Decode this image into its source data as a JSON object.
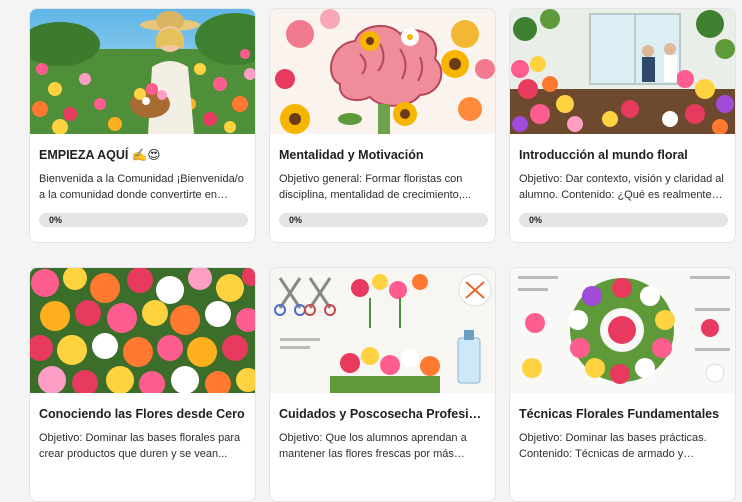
{
  "courses": [
    {
      "title": "EMPIEZA AQUÍ ✍️😍",
      "description": "Bienvenida a la Comunidad ¡Bienvenida/o a la comunidad donde convertirte en florista...",
      "progress_label": "0%",
      "progress": 0,
      "image": "woman-in-flower-field"
    },
    {
      "title": "Mentalidad y Motivación",
      "description": "Objetivo general: Formar floristas con disciplina, mentalidad de crecimiento,...",
      "progress_label": "0%",
      "progress": 0,
      "image": "brain-with-flowers"
    },
    {
      "title": "Introducción al mundo floral",
      "description": "Objetivo: Dar contexto, visión y claridad al alumno. Contenido: ¿Qué es realmente ser...",
      "progress_label": "0%",
      "progress": 0,
      "image": "flower-shop-interior"
    },
    {
      "title": "Conociendo las Flores desde Cero",
      "description": "Objetivo: Dominar las bases florales para crear productos que duren y se vean...",
      "image": "colorful-flower-bouquet"
    },
    {
      "title": "Cuidados y Poscosecha Profesional",
      "description": "Objetivo: Que los alumnos aprendan a mantener las flores frescas por más tiempo...",
      "image": "flower-care-tools-infographic"
    },
    {
      "title": "Técnicas Florales Fundamentales",
      "description": "Objetivo: Dominar las bases prácticas. Contenido: Técnicas de armado y control...",
      "image": "floral-wreath-techniques-infographic"
    }
  ],
  "colors": {
    "accent": "#7c3aed",
    "progress_track": "#e4e4e7",
    "page_background": "#f4f4f5"
  }
}
